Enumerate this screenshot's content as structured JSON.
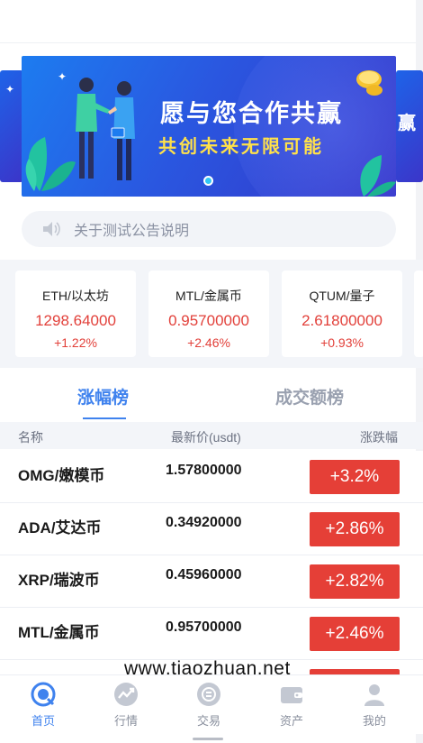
{
  "banner": {
    "title": "愿与您合作共赢",
    "subtitle": "共创未来无限可能",
    "side_text": "赢"
  },
  "notice": {
    "icon": "speaker-icon",
    "text": "关于测试公告说明"
  },
  "tickers": [
    {
      "name": "ETH/以太坊",
      "price": "1298.64000",
      "change": "+1.22%"
    },
    {
      "name": "MTL/金属币",
      "price": "0.95700000",
      "change": "+2.46%"
    },
    {
      "name": "QTUM/量子",
      "price": "2.61800000",
      "change": "+0.93%"
    }
  ],
  "tabs": {
    "active": "涨幅榜",
    "inactive": "成交额榜"
  },
  "table": {
    "headers": {
      "name": "名称",
      "price": "最新价(usdt)",
      "change": "涨跌幅"
    },
    "rows": [
      {
        "coin": "OMG/嫩模币",
        "price": "1.57800000",
        "change": "+3.2%"
      },
      {
        "coin": "ADA/艾达币",
        "price": "0.34920000",
        "change": "+2.86%"
      },
      {
        "coin": "XRP/瑞波币",
        "price": "0.45960000",
        "change": "+2.82%"
      },
      {
        "coin": "MTL/金属币",
        "price": "0.95700000",
        "change": "+2.46%"
      }
    ]
  },
  "watermark": "www.tiaozhuan.net",
  "nav": [
    {
      "label": "首页",
      "icon": "home-icon",
      "active": true
    },
    {
      "label": "行情",
      "icon": "market-trend-icon",
      "active": false
    },
    {
      "label": "交易",
      "icon": "trade-icon",
      "active": false
    },
    {
      "label": "资产",
      "icon": "wallet-icon",
      "active": false
    },
    {
      "label": "我的",
      "icon": "user-icon",
      "active": false
    }
  ],
  "colors": {
    "accent": "#3f82ee",
    "rise": "#e53f37",
    "banner_start": "#1d7cf0",
    "banner_end": "#3534c8"
  }
}
